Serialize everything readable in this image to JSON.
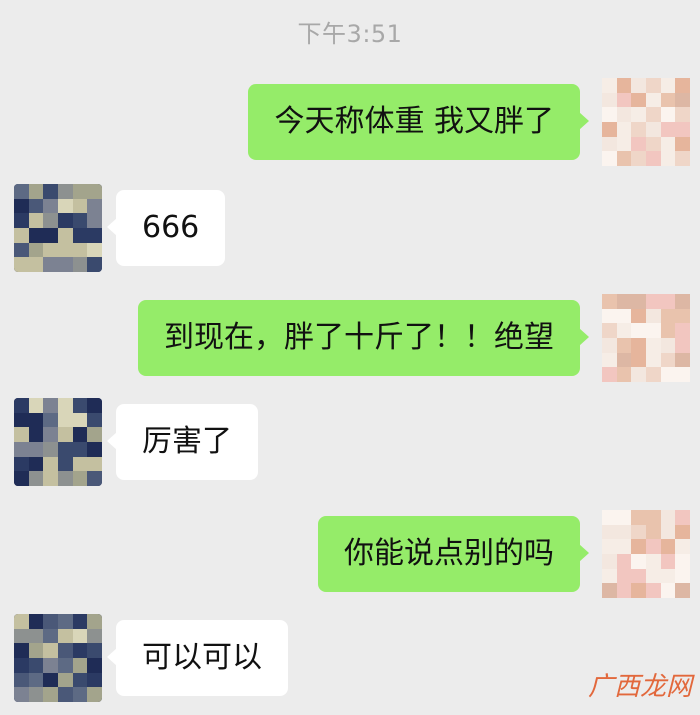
{
  "header": {
    "timestamp": "下午3:51"
  },
  "messages": [
    {
      "side": "self",
      "text": "今天称体重 我又胖了"
    },
    {
      "side": "other",
      "text": "666"
    },
    {
      "side": "self",
      "text": "到现在，胖了十斤了！！绝望"
    },
    {
      "side": "other",
      "text": "厉害了"
    },
    {
      "side": "self",
      "text": "你能说点别的吗"
    },
    {
      "side": "other",
      "text": "可以可以"
    }
  ],
  "colors": {
    "background": "#ececec",
    "self_bubble": "#95ec69",
    "other_bubble": "#ffffff",
    "timestamp_text": "#a8a8a8"
  },
  "icons": {
    "self_avatar": "pixelated-avatar-self",
    "other_avatar": "pixelated-avatar-other"
  },
  "watermark": {
    "text": "广西龙网"
  }
}
